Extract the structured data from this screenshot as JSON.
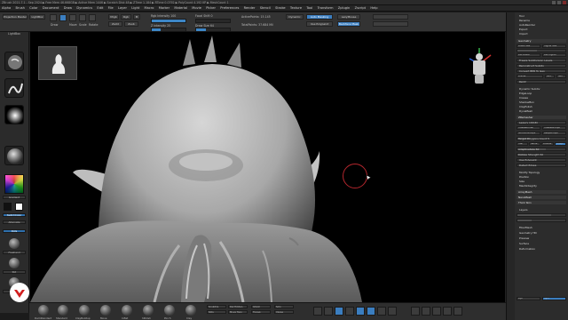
{
  "app": {
    "title_bar": "ZBrush 2021.7.1 - Sep 2024 ▶ Free Mem 46.668GB ▶ Active Mem 1446 ▶ Scratch Disk 48 ▶ ZTime 1.184 ▶ RTime 0.0792 ▶ PolyCount 4.192 KP ▶ MeshCount 1"
  },
  "menu": [
    "Alpha",
    "Brush",
    "Color",
    "Document",
    "Draw",
    "Dynamics",
    "Edit",
    "File",
    "Layer",
    "Light",
    "Macro",
    "Marker",
    "Material",
    "Movie",
    "Picker",
    "Preferences",
    "Render",
    "Stencil",
    "Stroke",
    "Texture",
    "Tool",
    "Transform",
    "Zplugin",
    "Zscript",
    "Help"
  ],
  "toolbar": {
    "lightbox": "LightBox",
    "draw": "Draw",
    "move": "Move",
    "scale": "Scale",
    "rotate": "Rotate",
    "mrgb": "Mrgb",
    "rgb": "Rgb",
    "m": "M",
    "zadd": "Zadd",
    "zsub": "Zsub",
    "focal_shift_label": "Focal Shift 0",
    "draw_size_label": "Draw Size 64",
    "rgb_intensity_label": "Rgb Intensity 100",
    "z_intensity_label": "Z Intensity 25",
    "active_points": "ActivePoints: 15.145",
    "total_points": "TotalPoints: 37.684 Mil",
    "dynamic": "Dynamic",
    "auto_mask": "Auto Masking",
    "polypaint": "Use Polypaint",
    "lazy_mouse": "LazyMouse",
    "backface": "Backface Mask",
    "focal_shift_value": 0.0,
    "draw_size_value": 0.3,
    "rgb_value": 1.0,
    "z_value": 0.25
  },
  "left_shelf": {
    "title": "Projection Master",
    "lightbox_btn": "LightBox",
    "gradient": "Gradient",
    "switch_color": "SwitchColor",
    "alternate": "Alternate",
    "labels": [
      "Dots",
      "Freehand",
      "Std",
      "Clay",
      "Mask",
      "SelectRect"
    ]
  },
  "bottom_shelf": {
    "items": [
      "DamStandard",
      "Standard",
      "ClayBuildup",
      "Move",
      "Inflat",
      "hPolish",
      "Pinch",
      "Clay",
      "Move Topo"
    ],
    "mini_left": [
      "Sculptris",
      "SDiv",
      "Del Hidden"
    ],
    "mini_right": [
      "Ghost",
      "Transp",
      "Solo",
      "Xpose"
    ]
  },
  "right_palette": {
    "top_items": [
      "Tool",
      "Rename",
      "AutoReorder",
      "Export",
      "Import"
    ],
    "subtool_header": "Geometry",
    "geometry": [
      "Lower Res",
      "Higher Res",
      "SDiv",
      "Del Lower",
      "Del Higher",
      "Freeze SubDivision Levels",
      "Reconstruct Subdiv",
      "Convert BPR To Geo",
      "Divide",
      "Smt",
      "Suv",
      "ReUV"
    ],
    "sections": [
      "Dynamic Subdiv",
      "EdgeLoop",
      "Crease",
      "ShadowBox",
      "ClayPolish",
      "DynaMesh",
      "ZRemesher",
      "Modify Topology",
      "Position",
      "Size",
      "MeshIntegrity"
    ],
    "zremesher": [
      "ZRemesher",
      "Legacy (2018)",
      "FreezeBorder",
      "FreezeGroups",
      "SmoothGroups",
      "KeepGroups",
      "Target Polygons Count 5",
      "Half",
      "Same",
      "Double",
      "Adapt",
      "AdaptiveSize 50",
      "Curves Strength 50",
      "Use Polypaint",
      "Detect Edges"
    ],
    "lower": [
      "ArrayMesh",
      "NanoMesh",
      "Thick Skin",
      "Layers",
      "FiberMesh",
      "Geometry HD",
      "Preview",
      "Surface",
      "Deformation"
    ],
    "bottom_labels": [
      "Dyn",
      "Sym"
    ],
    "slider_fills": [
      0.4,
      0.25,
      0.6,
      0.15,
      0.7,
      0.3
    ]
  },
  "colors": {
    "accent": "#3d86c6",
    "cursor": "#b3262d",
    "logo": "#d11f1f"
  }
}
